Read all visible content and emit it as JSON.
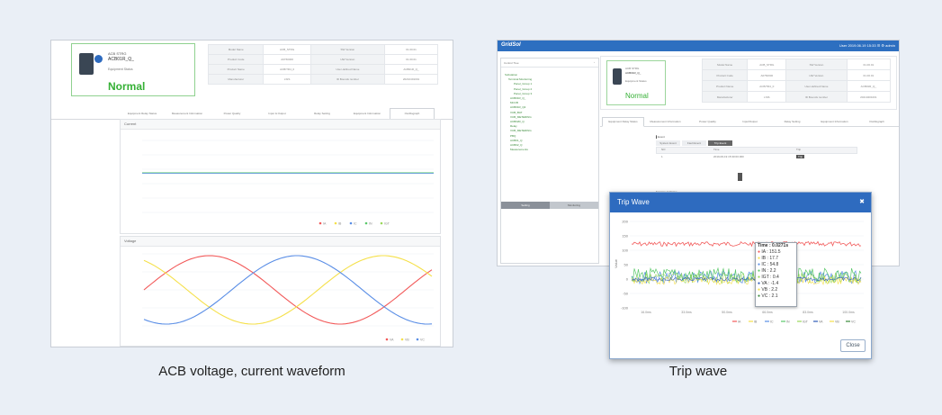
{
  "captions": {
    "left": "ACB voltage, current waveform",
    "right": "Trip wave"
  },
  "colors": {
    "accent_blue": "#2e6bbf",
    "normal_green": "#35b035",
    "series_red": "#f25a5a",
    "series_yellow": "#f5e04a",
    "series_blue": "#5a8ee6",
    "series_green": "#5ac86a"
  },
  "left_shot": {
    "device": {
      "name": "ACB STRG",
      "id": "ACB01R_Q_",
      "status_label": "Equipment Status",
      "status_value": "Normal"
    },
    "info_table": [
      [
        "Model Name",
        "ACB_STRG",
        "SW Version",
        "01.00.01"
      ],
      [
        "Product Code",
        "A0760000",
        "HW Version",
        "01.00.01"
      ],
      [
        "Product Name",
        "ACB/TR4_0",
        "User-defined Name",
        "ACB01R_Q_"
      ],
      [
        "Manufacturer",
        "LSIS",
        "ID Bounds number",
        "20210401001"
      ]
    ],
    "tabs": [
      "Equipment Relay Status",
      "Measurement Information",
      "Power Quality",
      "Input & Output",
      "Relay Setting",
      "Equipment Information",
      "Oscillograph"
    ],
    "active_tab": 6,
    "current_panel": {
      "title": "Current",
      "legend": [
        "IA",
        "IB",
        "IC",
        "IN",
        "IGT"
      ]
    },
    "voltage_panel": {
      "title": "Voltage",
      "legend": [
        "VA",
        "VB",
        "VC"
      ]
    }
  },
  "right_shot": {
    "app_logo": "GridSol",
    "header_right": "User  2019.06.19 15:33  ☰  ⚙  admin",
    "tree_title": "Control Tree",
    "tree_items": [
      "Substation",
      "Terminal Monitoring",
      "Panel_Group 1",
      "Panel_Group 2",
      "Panel_Group 3",
      "ACB01R_Q_",
      "MCCB",
      "ACB01R_Q2",
      "VCB_BAT",
      "VCB_METERING",
      "ACB02R_Q",
      "Relay",
      "VCB_METERING",
      "PBQ",
      "ACB01_Q",
      "ACB02_Q",
      "Measurements"
    ],
    "side_buttons": [
      "Setting",
      "Monitoring"
    ],
    "tabs": [
      "Equipment Relay Status",
      "Measurement Information",
      "Power Quality",
      "Input/Output",
      "Relay Setting",
      "Equipment Information",
      "Oscillograph"
    ],
    "sub_tabs": [
      "System Event",
      "Fault Event",
      "Trip Event"
    ],
    "event_cols": [
      "NO",
      "Time",
      "Trip"
    ],
    "event_row": [
      "1",
      "2019-06-19 15:30:00.000",
      "Trip"
    ],
    "equipment_label": "Equipment Status"
  },
  "trip_wave": {
    "title": "Trip Wave",
    "close_label": "Close",
    "ylabel": "Value",
    "tooltip": {
      "time": "Time : 0.0271s",
      "rows": [
        {
          "label": "IA : 151.5",
          "color": "#f25a5a"
        },
        {
          "label": "IB : 17.7",
          "color": "#f5e04a"
        },
        {
          "label": "IC : 54.8",
          "color": "#5a8ee6"
        },
        {
          "label": "IN : 2.2",
          "color": "#5ac86a"
        },
        {
          "label": "IGT : 0.4",
          "color": "#9ad85a"
        },
        {
          "label": "VA : -1.4",
          "color": "#2e5bb8"
        },
        {
          "label": "VB : 2.2",
          "color": "#f5e04a"
        },
        {
          "label": "VC : 2.1",
          "color": "#3a8a3a"
        }
      ]
    },
    "legend": [
      "IA",
      "IB",
      "IC",
      "IN",
      "IGT",
      "VA",
      "VB",
      "VC"
    ],
    "yticks": [
      "200",
      "150",
      "100",
      "50",
      "0",
      "-50",
      "-100"
    ],
    "xticks": [
      "16.0ms",
      "33.0ms",
      "50.0ms",
      "66.0ms",
      "83.0ms",
      "100.0ms"
    ]
  }
}
